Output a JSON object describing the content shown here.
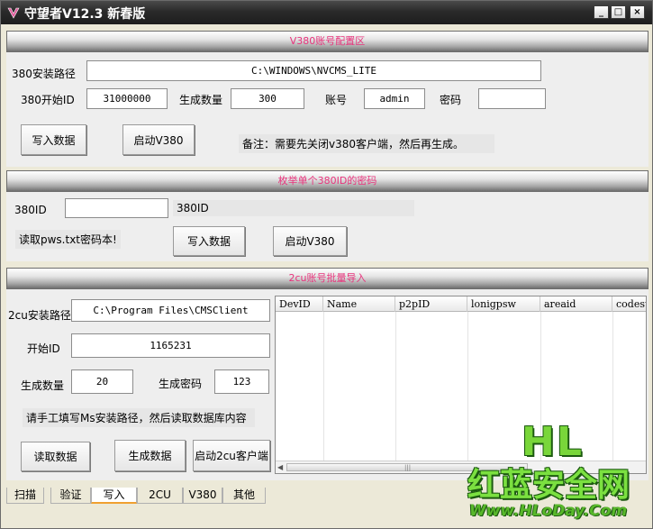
{
  "window": {
    "title": "守望者V12.3 新春版",
    "controls": {
      "minimize": "_",
      "maximize": "□",
      "close": "×"
    }
  },
  "section1": {
    "header": "V380账号配置区",
    "install_path_label": "380安装路径",
    "install_path_value": "C:\\WINDOWS\\NVCMS_LITE",
    "start_id_label": "380开始ID",
    "start_id_value": "31000000",
    "gen_count_label": "生成数量",
    "gen_count_value": "300",
    "account_label": "账号",
    "account_value": "admin",
    "password_label": "密码",
    "password_value": "",
    "write_button": "写入数据",
    "launch_button": "启动V380",
    "note": "备注：需要先关闭v380客户端，然后再生成。"
  },
  "section2": {
    "header": "枚举单个380ID的密码",
    "id_label": "380ID",
    "id_value": "",
    "id_suffix": "380ID",
    "read_label": "读取pws.txt密码本!",
    "write_button": "写入数据",
    "launch_button": "启动V380"
  },
  "section3": {
    "header": "2cu账号批量导入",
    "install_path_label": "2cu安装路径",
    "install_path_value": "C:\\Program Files\\CMSClient",
    "start_id_label": "开始ID",
    "start_id_value": "1165231",
    "gen_count_label": "生成数量",
    "gen_count_value": "20",
    "gen_password_label": "生成密码",
    "gen_password_value": "123",
    "hint": "请手工填写Ms安装路径，然后读取数据库内容",
    "read_button": "读取数据",
    "generate_button": "生成数据",
    "launch_button": "启动2cu客户端",
    "table": {
      "columns": [
        "DevID",
        "Name",
        "p2pID",
        "lonigpsw",
        "areaid",
        "codest"
      ],
      "rows": []
    }
  },
  "tabs": {
    "items": [
      "扫描",
      "验证",
      "写入",
      "2CU",
      "V380",
      "其他"
    ],
    "active": "写入"
  },
  "watermark": {
    "line1": "HL",
    "line2": "红蓝安全网",
    "line3": "Www.HLoDay.Com"
  },
  "colors": {
    "section_header_text": "#e8337c",
    "titlebar": "#2a2a2a",
    "watermark_green": "#79d63a"
  }
}
